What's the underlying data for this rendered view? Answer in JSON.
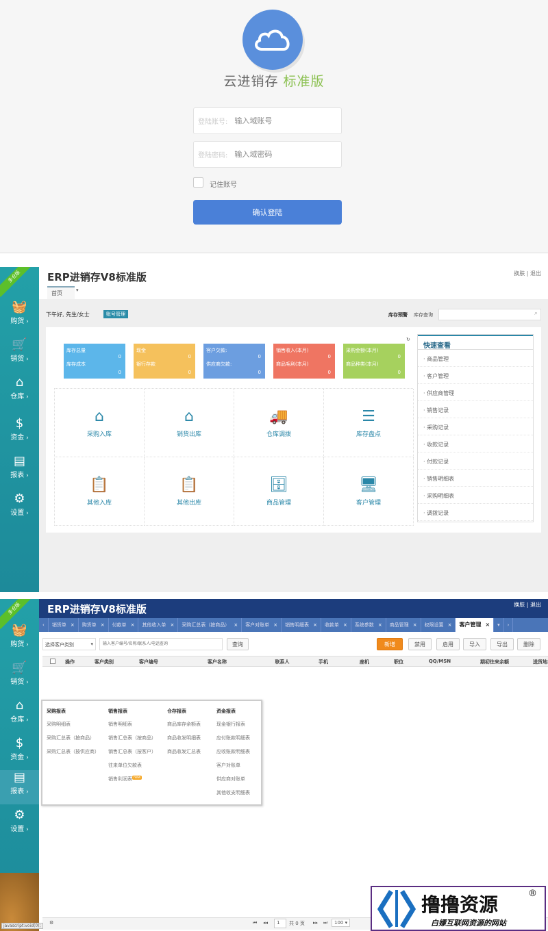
{
  "login": {
    "app_name": "云进销存",
    "edition": "标准版",
    "account_label": "登陆账号:",
    "account_placeholder": "输入域账号",
    "password_label": "登陆密码:",
    "password_placeholder": "输入域密码",
    "remember_label": "记住账号",
    "submit_label": "确认登陆",
    "logo_icon": "cloud-icon",
    "accent": "#4a80d8"
  },
  "sidebar": {
    "ribbon": "多仓版",
    "items": [
      {
        "label": "购货",
        "icon": "basket-icon"
      },
      {
        "label": "销货",
        "icon": "cart-icon"
      },
      {
        "label": "仓库",
        "icon": "warehouse-icon"
      },
      {
        "label": "资金",
        "icon": "dollar-icon"
      },
      {
        "label": "报表",
        "icon": "report-icon"
      },
      {
        "label": "设置",
        "icon": "gear-icon"
      }
    ]
  },
  "dashboard": {
    "title": "ERP进销存V8标准版",
    "header_links": [
      "换肤",
      "退出"
    ],
    "tab": "首页",
    "greeting": "下午好, 先生/女士",
    "account_button": "账号管理",
    "stock_warning": "库存预警",
    "stock_query": "库存查询",
    "cards": [
      {
        "label1": "库存总量",
        "value1": "0",
        "label2": "库存成本",
        "value2": "0",
        "color": "#5cb6ea"
      },
      {
        "label1": "现金",
        "value1": "0",
        "label2": "银行存款",
        "value2": "0",
        "color": "#f5c15c"
      },
      {
        "label1": "客户欠款:",
        "value1": "0",
        "label2": "供应商欠款:",
        "value2": "0",
        "color": "#6c9ee0"
      },
      {
        "label1": "销售收入(本月)",
        "value1": "0",
        "label2": "商品毛利(本月)",
        "value2": "0",
        "color": "#ef7562"
      },
      {
        "label1": "采购金额(本月)",
        "value1": "0",
        "label2": "商品种类(本月)",
        "value2": "0",
        "color": "#a6d15e"
      }
    ],
    "tiles": [
      "采购入库",
      "销货出库",
      "仓库调拨",
      "库存盘点",
      "其他入库",
      "其他出库",
      "商品管理",
      "客户管理"
    ],
    "quick_view": {
      "title": "快速查看",
      "items": [
        "商品管理",
        "客户管理",
        "供应商管理",
        "销售记录",
        "采购记录",
        "收款记录",
        "付款记录",
        "销售明细表",
        "采购明细表",
        "调拨记录"
      ]
    }
  },
  "customer": {
    "title": "ERP进销存V8标准版",
    "header_links": [
      "换肤",
      "退出"
    ],
    "tabs": [
      "销货单",
      "购货单",
      "付款单",
      "其他收入单",
      "采购汇总表（按商品）",
      "客户对账单",
      "销售明细表",
      "收款单",
      "系统参数",
      "商品管理",
      "权限设置",
      "客户管理"
    ],
    "active_tab": "客户管理",
    "category_select": "选择客户类别",
    "search_placeholder": "输入客户编号/名称/联系人/电话查询",
    "query_button": "查询",
    "actions": [
      "新增",
      "禁用",
      "启用",
      "导入",
      "导出",
      "删除"
    ],
    "columns": [
      "操作",
      "客户类别",
      "客户编号",
      "客户名称",
      "联系人",
      "手机",
      "座机",
      "职位",
      "QQ/MSN",
      "期初往来余额",
      "送货地址"
    ],
    "report_menu": [
      {
        "title": "采购报表",
        "items": [
          "采购明细表",
          "采购汇总表（按商品）",
          "采购汇总表（按供应商）"
        ]
      },
      {
        "title": "销售报表",
        "items": [
          "销售明细表",
          "销售汇总表（按商品）",
          "销售汇总表（按客户）",
          "往来单位欠款表",
          "销售利润表"
        ]
      },
      {
        "title": "仓存报表",
        "items": [
          "商品库存余额表",
          "商品收发明细表",
          "商品收发汇总表"
        ]
      },
      {
        "title": "资金报表",
        "items": [
          "现金银行报表",
          "应付账款明细表",
          "应收账款明细表",
          "客户对账单",
          "供应商对账单",
          "其他收支明细表"
        ]
      }
    ],
    "new_badge": "new",
    "pagination": {
      "page": "1",
      "total": "共 0 页",
      "page_size": "100"
    },
    "status_text": "javascript:void(0);"
  },
  "watermark": {
    "brand": "撸撸资源",
    "registered": "®",
    "slogan": "白嫖互联网资源的网站"
  }
}
